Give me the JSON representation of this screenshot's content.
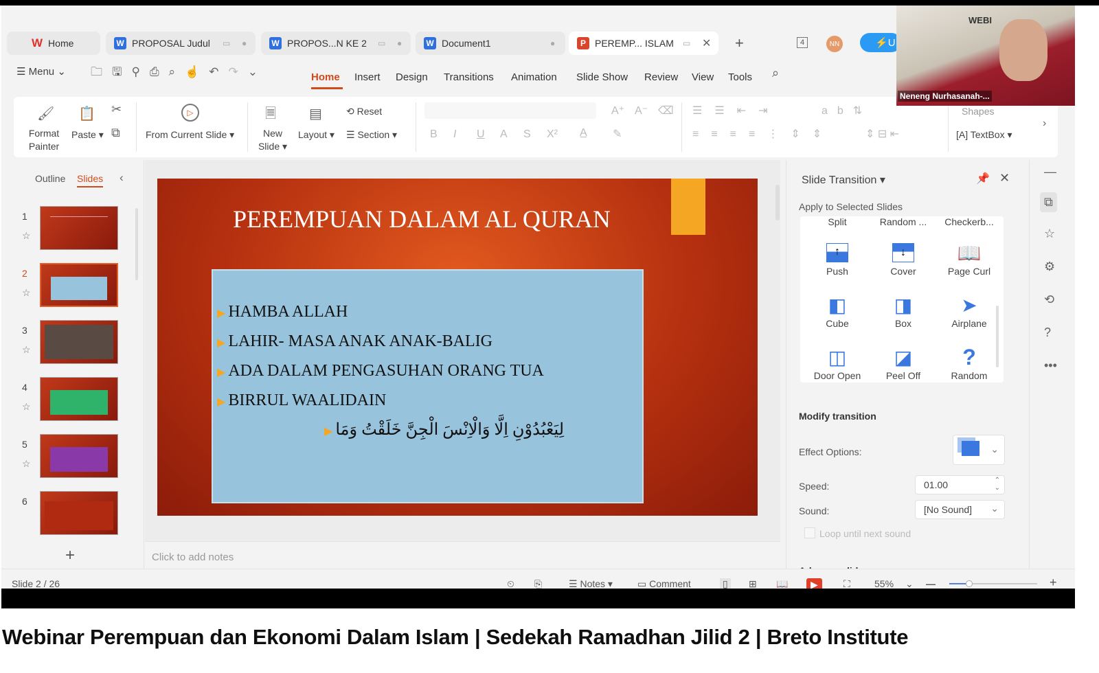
{
  "tabs": [
    {
      "label": "Home",
      "icon": "wps-logo"
    },
    {
      "label": "PROPOSAL Judul",
      "icon": "W"
    },
    {
      "label": "PROPOS...N KE 2",
      "icon": "W"
    },
    {
      "label": "Document1",
      "icon": "W"
    },
    {
      "label": "PEREMP... ISLAM",
      "icon": "P",
      "active": true
    }
  ],
  "tabbar": {
    "new_tab": "+",
    "badge": "4",
    "avatar": "NN",
    "upgrade": "U"
  },
  "menubar": {
    "menu_label": "Menu",
    "tabs": [
      "Home",
      "Insert",
      "Design",
      "Transitions",
      "Animation",
      "Slide Show",
      "Review",
      "View",
      "Tools"
    ],
    "active": "Home"
  },
  "ribbon": {
    "format_painter": "Format Painter",
    "paste": "Paste",
    "from_current_slide": "From Current Slide",
    "new_slide": "New Slide",
    "layout": "Layout",
    "reset": "Reset",
    "section": "Section",
    "shapes": "Shapes",
    "textbox": "TextBox"
  },
  "left_panel": {
    "outline": "Outline",
    "slides": "Slides",
    "active": "Slides",
    "slide_numbers": [
      "1",
      "2",
      "3",
      "4",
      "5",
      "6"
    ],
    "selected": 2,
    "add": "+"
  },
  "slide": {
    "title": "PEREMPUAN DALAM AL QURAN",
    "bullets": [
      "HAMBA ALLAH",
      "LAHIR- MASA ANAK ANAK-BALIG",
      "ADA DALAM PENGASUHAN ORANG TUA",
      "BIRRUL WAALIDAIN"
    ],
    "arabic": "لِيَعْبُدُوْنِ اِلَّا وَالْاِنْسَ الْجِنَّ خَلَقْتُ وَمَا",
    "bg": "#b5300f",
    "box": "#98c3dc",
    "accent": "#f5a623"
  },
  "notes_placeholder": "Click to add notes",
  "transition_panel": {
    "title": "Slide Transition",
    "apply_label": "Apply to Selected Slides",
    "top_row": [
      "Split",
      "Random ...",
      "Checkerb..."
    ],
    "items": [
      {
        "label": "Push",
        "icon": "push-icon"
      },
      {
        "label": "Cover",
        "icon": "cover-icon"
      },
      {
        "label": "Page Curl",
        "icon": "page-curl-icon"
      },
      {
        "label": "Cube",
        "icon": "cube-icon"
      },
      {
        "label": "Box",
        "icon": "box-icon"
      },
      {
        "label": "Airplane",
        "icon": "airplane-icon"
      },
      {
        "label": "Door Open",
        "icon": "door-open-icon"
      },
      {
        "label": "Peel Off",
        "icon": "peel-off-icon"
      },
      {
        "label": "Random",
        "icon": "question-icon"
      }
    ],
    "modify_heading": "Modify transition",
    "effect_options_label": "Effect Options:",
    "speed_label": "Speed:",
    "speed_value": "01.00",
    "sound_label": "Sound:",
    "sound_value": "[No Sound]",
    "loop_label": "Loop until next sound",
    "loop_checked": false,
    "advance_heading": "Advance slide",
    "accent": "#3a78e0"
  },
  "statusbar": {
    "slide_info": "Slide 2 / 26",
    "notes": "Notes",
    "comment": "Comment",
    "zoom": "55%",
    "zoom_level": 0.55
  },
  "webcam": {
    "name": "Neneng Nurhasanah-...",
    "banner": "WEBI"
  },
  "video_title": "Webinar Perempuan dan Ekonomi Dalam Islam | Sedekah Ramadhan Jilid 2 | Breto Institute"
}
